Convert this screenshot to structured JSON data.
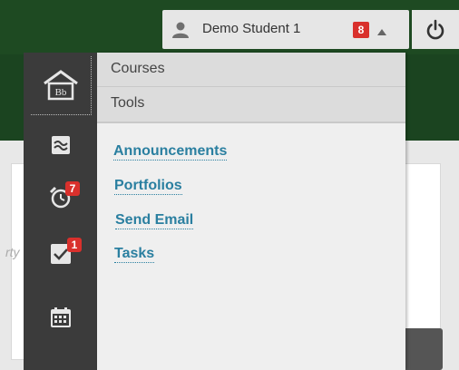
{
  "header": {
    "user_name": "Demo Student 1",
    "notification_count": "8"
  },
  "rail": {
    "due_badge": "7",
    "tasks_badge": "1"
  },
  "panel": {
    "courses_label": "Courses",
    "tools_label": "Tools",
    "tools": [
      "Announcements",
      "Portfolios",
      "Send Email",
      "Tasks"
    ]
  },
  "background": {
    "partial_text": "rty"
  },
  "colors": {
    "header_green": "#1e4a22",
    "rail_dark": "#3b3b3b",
    "link_blue": "#2a7fa0",
    "badge_red": "#d9302c"
  },
  "icons": [
    "user-icon",
    "caret-up-icon",
    "power-icon",
    "home-icon",
    "stream-icon",
    "alarm-clock-icon",
    "tasks-icon",
    "calendar-icon"
  ]
}
